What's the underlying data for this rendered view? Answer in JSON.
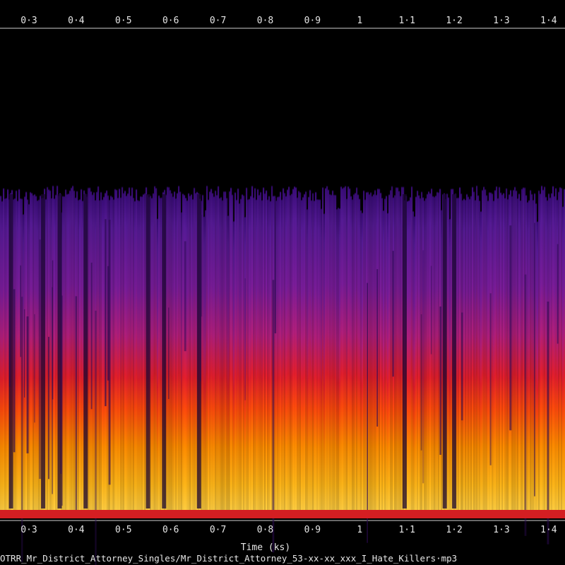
{
  "chart_data": {
    "type": "heatmap",
    "subtype": "spectrogram",
    "colormap": [
      "#000000",
      "#2a0a6e",
      "#6a1a9a",
      "#a0208c",
      "#d8203c",
      "#ff3a10",
      "#ff8a00",
      "#ffc820",
      "#ffff88"
    ],
    "xlabel": "Time (ks)",
    "x_ticks": [
      {
        "value": 0.3,
        "label": "0·3"
      },
      {
        "value": 0.4,
        "label": "0·4"
      },
      {
        "value": 0.5,
        "label": "0·5"
      },
      {
        "value": 0.6,
        "label": "0·6"
      },
      {
        "value": 0.7,
        "label": "0·7"
      },
      {
        "value": 0.8,
        "label": "0·8"
      },
      {
        "value": 0.9,
        "label": "0·9"
      },
      {
        "value": 1.0,
        "label": "1"
      },
      {
        "value": 1.1,
        "label": "1·1"
      },
      {
        "value": 1.2,
        "label": "1·2"
      },
      {
        "value": 1.3,
        "label": "1·3"
      },
      {
        "value": 1.4,
        "label": "1·4"
      }
    ],
    "xlim": [
      0.24,
      1.43
    ],
    "tick_rows": [
      "top",
      "bottom"
    ],
    "filename": "OTRR_Mr_District_Attorney_Singles/Mr_District_Attorney_53-xx-xx_xxx_I_Hate_Killers·mp3",
    "silent_gaps_ks": [
      0.262,
      0.33,
      0.365,
      0.42,
      0.552,
      0.586,
      0.66,
      1.095,
      1.18,
      1.2
    ],
    "energy_profile": "Energy concentrated in lower frequencies (bright yellow/orange), fading through red and magenta to purple at upper-mid frequencies; upper band is silent (black)"
  }
}
